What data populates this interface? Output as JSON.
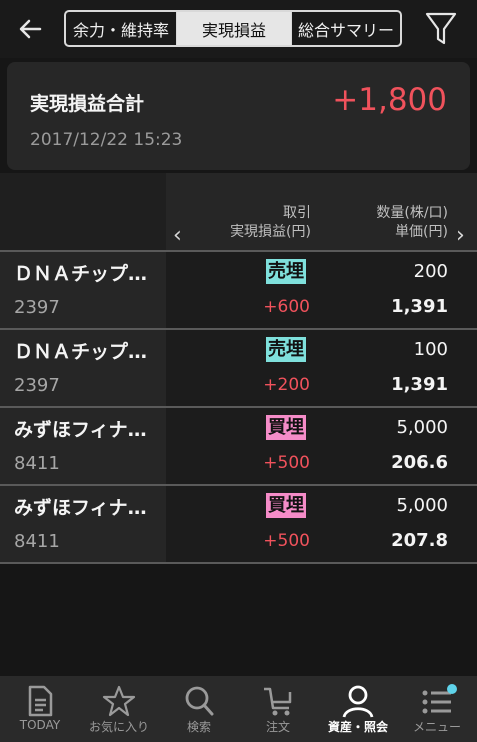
{
  "header": {
    "tabs": [
      {
        "label": "余力・維持率"
      },
      {
        "label": "実現損益"
      },
      {
        "label": "総合サマリー"
      }
    ]
  },
  "summary": {
    "label": "実現損益合計",
    "value": "+1,800",
    "timestamp": "2017/12/22 15:23"
  },
  "table": {
    "col1_top": "取引",
    "col1_bottom": "実現損益(円)",
    "col2_top": "数量(株/口)",
    "col2_bottom": "単価(円)",
    "rows": [
      {
        "name": "ＤＮＡチップ…",
        "code": "2397",
        "side": "売埋",
        "pnl": "+600",
        "qty": "200",
        "price": "1,391"
      },
      {
        "name": "ＤＮＡチップ…",
        "code": "2397",
        "side": "売埋",
        "pnl": "+200",
        "qty": "100",
        "price": "1,391"
      },
      {
        "name": "みずほフィナ…",
        "code": "8411",
        "side": "買埋",
        "pnl": "+500",
        "qty": "5,000",
        "price": "206.6"
      },
      {
        "name": "みずほフィナ…",
        "code": "8411",
        "side": "買埋",
        "pnl": "+500",
        "qty": "5,000",
        "price": "207.8"
      }
    ]
  },
  "nav": {
    "items": [
      {
        "label": "TODAY",
        "icon": "document-icon"
      },
      {
        "label": "お気に入り",
        "icon": "star-icon"
      },
      {
        "label": "検索",
        "icon": "search-icon"
      },
      {
        "label": "注文",
        "icon": "cart-icon"
      },
      {
        "label": "資産・照会",
        "icon": "person-icon"
      },
      {
        "label": "メニュー",
        "icon": "menu-icon"
      }
    ]
  },
  "colors": {
    "positive": "#f0525c",
    "sell_tag": "#7fe0dc",
    "buy_tag": "#f58cc8",
    "notification_dot": "#5fd3ea"
  }
}
